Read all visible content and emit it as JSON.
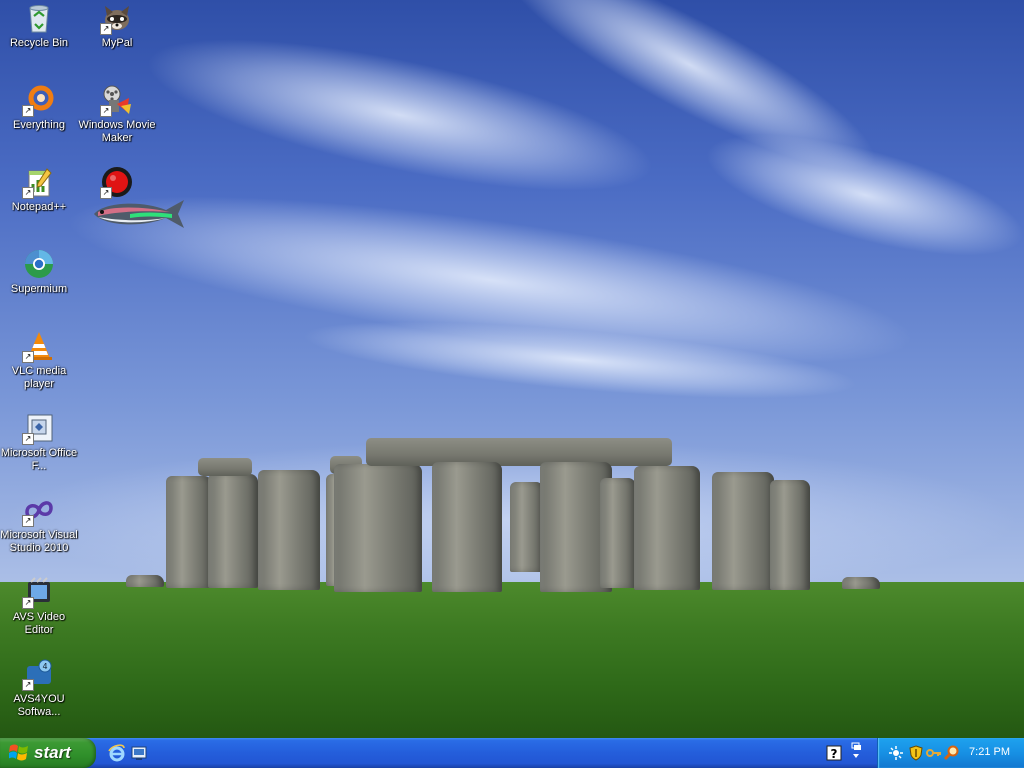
{
  "desktop": {
    "icons": [
      {
        "id": "recycle-bin",
        "label": "Recycle Bin",
        "icon": "recycle-bin-icon"
      },
      {
        "id": "mypal",
        "label": "MyPal",
        "icon": "mypal-icon"
      },
      {
        "id": "everything",
        "label": "Everything",
        "icon": "everything-icon"
      },
      {
        "id": "windows-movie-maker",
        "label": "Windows Movie Maker",
        "icon": "movie-maker-icon"
      },
      {
        "id": "notepad-plus-plus",
        "label": "Notepad++",
        "icon": "notepad-plus-plus-icon"
      },
      {
        "id": "record",
        "label": "",
        "icon": "record-icon"
      },
      {
        "id": "supermium",
        "label": "Supermium",
        "icon": "supermium-icon"
      },
      {
        "id": "vlc",
        "label": "VLC media player",
        "icon": "vlc-icon"
      },
      {
        "id": "ms-office",
        "label": "Microsoft Office F...",
        "icon": "office-icon"
      },
      {
        "id": "ms-visual-studio",
        "label": "Microsoft Visual Studio 2010",
        "icon": "visual-studio-icon"
      },
      {
        "id": "avs-video-editor",
        "label": "AVS Video Editor",
        "icon": "avs-video-editor-icon"
      },
      {
        "id": "avs4you",
        "label": "AVS4YOU Softwa...",
        "icon": "avs4you-icon"
      }
    ]
  },
  "taskbar": {
    "start_label": "start",
    "quick_launch": [
      "internet-explorer-icon",
      "show-desktop-icon"
    ],
    "tray_icons": [
      "help-icon",
      "restore-icon",
      "network-icon",
      "security-shield-icon",
      "key-icon",
      "search-icon"
    ],
    "clock": "7:21 PM"
  },
  "colors": {
    "taskbar": "#245edb",
    "start": "#3c9a34",
    "tray": "#1790e4",
    "sky": "#4b6cc4",
    "grass": "#3d7a22"
  }
}
